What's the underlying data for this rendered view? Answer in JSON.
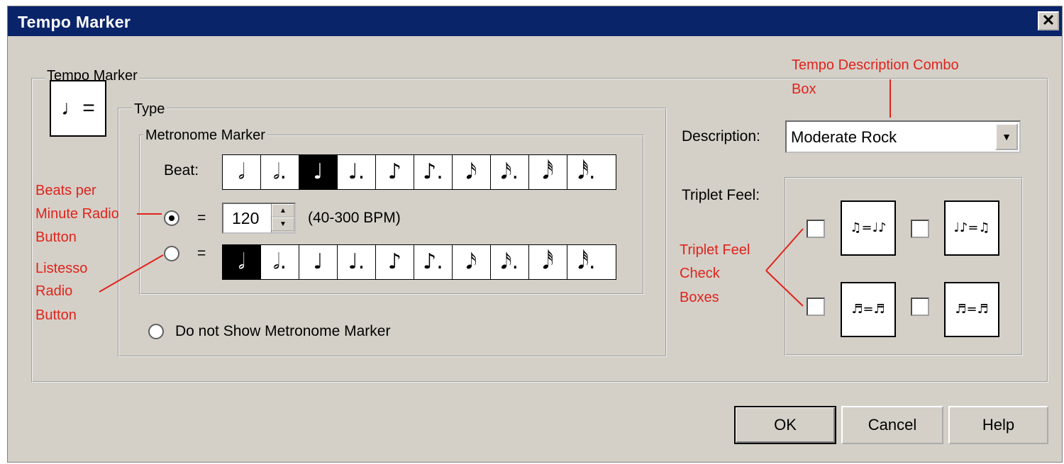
{
  "dialog": {
    "title": "Tempo Marker",
    "close_label": "✕"
  },
  "tempo_group": {
    "legend": "Tempo Marker",
    "note_icon": "♩="
  },
  "type_group": {
    "legend": "Type"
  },
  "metronome_group": {
    "legend": "Metronome Marker"
  },
  "beat": {
    "label": "Beat:",
    "selected_index": 2,
    "notes": [
      "𝅗𝅥",
      "𝅗𝅥.",
      "♩",
      "♩.",
      "♪",
      "♪.",
      "𝅘𝅥𝅯",
      "𝅘𝅥𝅯.",
      "𝅘𝅥𝅰",
      "𝅘𝅥𝅰."
    ]
  },
  "bpm": {
    "equals": "=",
    "value": "120",
    "range": "(40-300 BPM)",
    "selected": true
  },
  "listesso": {
    "equals": "=",
    "selected": false,
    "selected_index": 0,
    "notes": [
      "𝅗𝅥",
      "𝅗𝅥.",
      "♩",
      "♩.",
      "♪",
      "♪.",
      "𝅘𝅥𝅯",
      "𝅘𝅥𝅯.",
      "𝅘𝅥𝅰",
      "𝅘𝅥𝅰."
    ]
  },
  "no_marker": {
    "label": "Do not Show Metronome Marker",
    "selected": false
  },
  "description": {
    "label": "Description:",
    "value": "Moderate Rock"
  },
  "triplet": {
    "label": "Triplet Feel:",
    "options": [
      {
        "symbol": "♫=♩♪",
        "checked": false
      },
      {
        "symbol": "♩♪=♫",
        "checked": false
      },
      {
        "symbol": "♬=♬",
        "checked": false
      },
      {
        "symbol": "♬=♬",
        "checked": false
      }
    ]
  },
  "buttons": {
    "ok": "OK",
    "cancel": "Cancel",
    "help": "Help"
  },
  "annotations": {
    "tempo_combo": [
      "Tempo Description Combo",
      "Box"
    ],
    "bpm_radio": [
      "Beats per",
      "Minute Radio",
      "Button"
    ],
    "listesso_radio": [
      "Listesso",
      "Radio",
      "Button"
    ],
    "triplet_checks": [
      "Triplet Feel",
      "Check",
      "Boxes"
    ]
  },
  "colors": {
    "titlebar": "#0a246a",
    "dialog_bg": "#d4d0c8",
    "annotation": "#e0231b"
  }
}
